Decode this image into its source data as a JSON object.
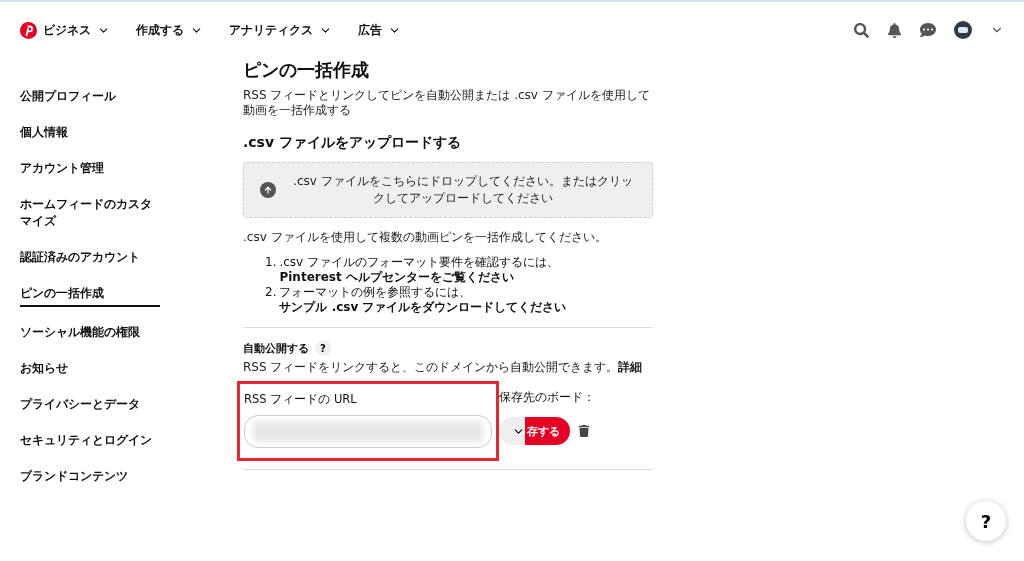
{
  "header": {
    "nav": [
      {
        "label": "ビジネス",
        "logo": true
      },
      {
        "label": "作成する",
        "logo": false
      },
      {
        "label": "アナリティクス",
        "logo": false
      },
      {
        "label": "広告",
        "logo": false
      }
    ]
  },
  "sidebar": {
    "items": [
      {
        "label": "公開プロフィール",
        "selected": false
      },
      {
        "label": "個人情報",
        "selected": false
      },
      {
        "label": "アカウント管理",
        "selected": false
      },
      {
        "label": "ホームフィードのカスタマイズ",
        "selected": false
      },
      {
        "label": "認証済みのアカウント",
        "selected": false
      },
      {
        "label": "ピンの一括作成",
        "selected": true
      },
      {
        "label": "ソーシャル機能の権限",
        "selected": false
      },
      {
        "label": "お知らせ",
        "selected": false
      },
      {
        "label": "プライバシーとデータ",
        "selected": false
      },
      {
        "label": "セキュリティとログイン",
        "selected": false
      },
      {
        "label": "ブランドコンテンツ",
        "selected": false
      }
    ]
  },
  "main": {
    "title": "ピンの一括作成",
    "description": "RSS フィードとリンクしてピンを自動公開または .csv ファイルを使用して動画を一括作成する",
    "upload_heading": ".csv ファイルをアップロードする",
    "dropzone": ".csv ファイルをこちらにドロップしてください。またはクリックしてアップロードしてください",
    "csv_note": ".csv ファイルを使用して複数の動画ピンを一括作成してください。",
    "steps": [
      {
        "number": "1.",
        "text": ".csv ファイルのフォーマット要件を確認するには、",
        "link": "Pinterest ヘルプセンターをご覧ください"
      },
      {
        "number": "2.",
        "text": "フォーマットの例を参照するには、",
        "link": "サンプル .csv ファイルをダウンロードしてください"
      }
    ],
    "auto_publish": {
      "heading": "自動公開する",
      "help": "?",
      "description": "RSS フィードをリンクすると、このドメインから自動公開できます。",
      "details_link": "詳細",
      "url_label": "RSS フィードの URL",
      "board_label": "保存先のボード：",
      "save_button": "存する"
    }
  },
  "help_button": "?"
}
